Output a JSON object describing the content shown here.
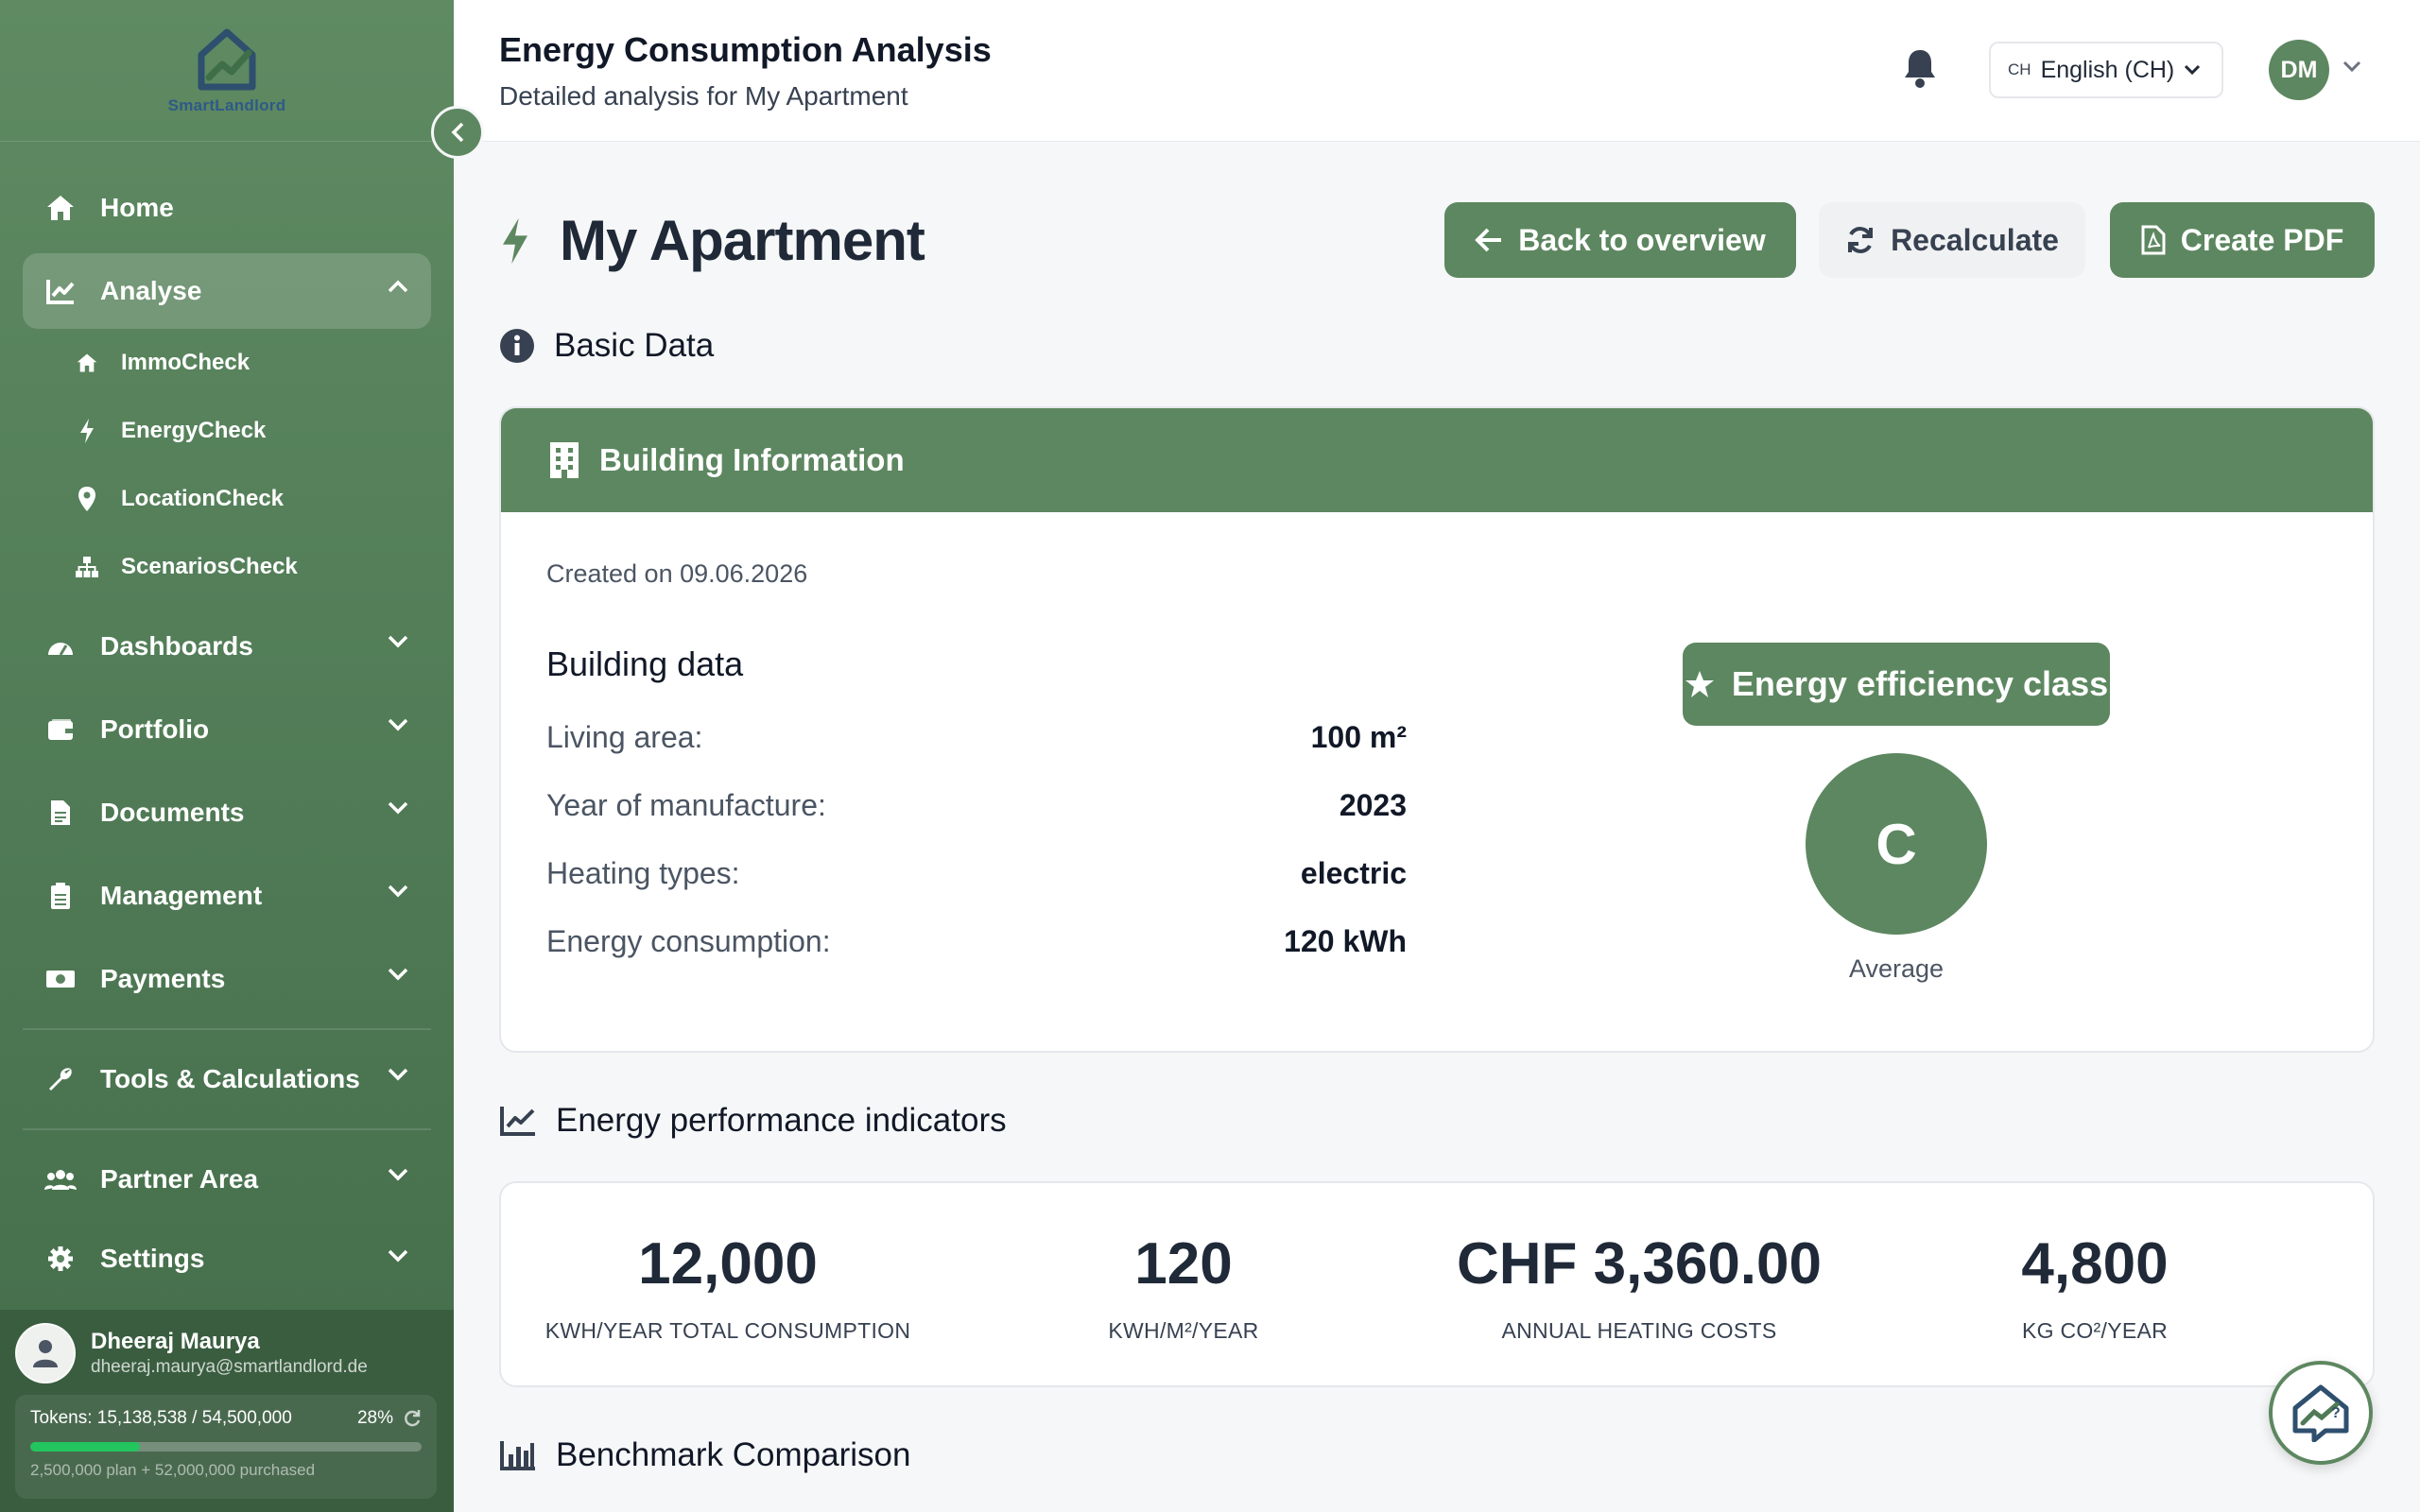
{
  "brand": {
    "name": "SmartLandlord",
    "primary_color": "#5d8760"
  },
  "header": {
    "title": "Energy Consumption Analysis",
    "subtitle": "Detailed analysis for My Apartment",
    "language": {
      "code": "CH",
      "label": "English (CH)"
    },
    "user_initials": "DM"
  },
  "sidebar": {
    "items": [
      {
        "label": "Home",
        "icon": "home-icon"
      },
      {
        "label": "Analyse",
        "icon": "chart-line-icon",
        "expanded": true,
        "children": [
          {
            "label": "ImmoCheck",
            "icon": "home-icon"
          },
          {
            "label": "EnergyCheck",
            "icon": "bolt-icon"
          },
          {
            "label": "LocationCheck",
            "icon": "map-pin-icon"
          },
          {
            "label": "ScenariosCheck",
            "icon": "sitemap-icon"
          }
        ]
      },
      {
        "label": "Dashboards",
        "icon": "gauge-icon"
      },
      {
        "label": "Portfolio",
        "icon": "wallet-icon"
      },
      {
        "label": "Documents",
        "icon": "document-icon"
      },
      {
        "label": "Management",
        "icon": "clipboard-icon"
      },
      {
        "label": "Payments",
        "icon": "money-icon"
      },
      {
        "label": "Tools & Calculations",
        "icon": "wrench-icon"
      },
      {
        "label": "Partner Area",
        "icon": "users-icon"
      },
      {
        "label": "Settings",
        "icon": "gear-icon"
      }
    ],
    "user": {
      "name": "Dheeraj Maurya",
      "email": "dheeraj.maurya@smartlandlord.de"
    },
    "tokens": {
      "label": "Tokens: 15,138,538 / 54,500,000",
      "percent_label": "28%",
      "fraction_used": 0.28,
      "detail": "2,500,000 plan + 52,000,000 purchased"
    }
  },
  "main": {
    "title": "My Apartment",
    "actions": {
      "back": "Back to overview",
      "recalc": "Recalculate",
      "pdf": "Create PDF"
    },
    "basic_data": {
      "heading": "Basic Data",
      "card_title": "Building Information",
      "created": "Created on 09.06.2026",
      "building_title": "Building data",
      "rows": [
        {
          "label": "Living area:",
          "value": "100 m²"
        },
        {
          "label": "Year of manufacture:",
          "value": "2023"
        },
        {
          "label": "Heating types:",
          "value": "electric"
        },
        {
          "label": "Energy consumption:",
          "value": "120 kWh"
        }
      ],
      "efficiency": {
        "button": "Energy efficiency class",
        "class": "C",
        "rating": "Average"
      }
    },
    "indicators": {
      "heading": "Energy performance indicators",
      "items": [
        {
          "value": "12,000",
          "caption": "KWH/YEAR TOTAL CONSUMPTION"
        },
        {
          "value": "120",
          "caption": "KWH/M²/YEAR"
        },
        {
          "value": "CHF 3,360.00",
          "caption": "ANNUAL HEATING COSTS"
        },
        {
          "value": "4,800",
          "caption": "KG CO²/YEAR"
        }
      ]
    },
    "benchmark": {
      "heading": "Benchmark Comparison"
    }
  }
}
